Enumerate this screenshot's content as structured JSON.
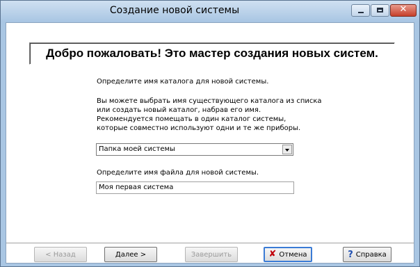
{
  "window": {
    "title": "Создание новой системы",
    "close_glyph": "✕"
  },
  "banner": {
    "text": "Добро пожаловать! Это мастер создания новых систем."
  },
  "content": {
    "catalog_prompt": "Определите имя каталога для новой системы.",
    "catalog_help_lines": [
      "Вы можете выбрать имя существующего каталога из списка",
      "или создать новый каталог, набрав его имя.",
      "Рекомендуется помещать в один каталог системы,",
      "которые совместно используют одни и те же приборы."
    ],
    "catalog_select_value": "Папка моей системы",
    "file_prompt": "Определите имя файла для новой системы.",
    "file_input_value": "Моя первая система"
  },
  "buttons": {
    "back": "< Назад",
    "next": "Далее >",
    "finish": "Завершить",
    "cancel": "Отмена",
    "cancel_icon": "x-icon",
    "help": "Справка",
    "help_icon": "question-icon"
  }
}
